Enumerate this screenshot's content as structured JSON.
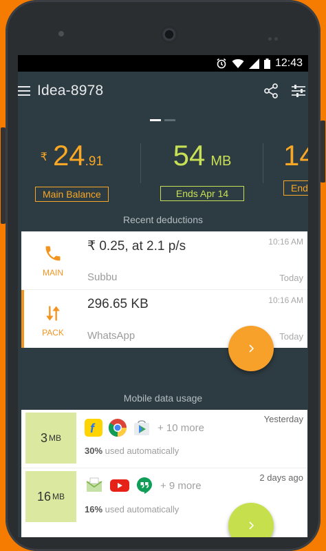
{
  "status": {
    "time": "12:43"
  },
  "appbar": {
    "title": "Idea-8978"
  },
  "balances": [
    {
      "symbol": "₹",
      "whole": "24",
      "decimal": ".91",
      "label": "Main Balance"
    },
    {
      "amount": "54",
      "unit": "MB",
      "label": "Ends Apr 14"
    },
    {
      "amount": "14",
      "label": "End"
    }
  ],
  "recent": {
    "title": "Recent deductions",
    "items": [
      {
        "type": "MAIN",
        "main": "₹ 0.25, at 2.1 p/s",
        "who": "Subbu",
        "time": "10:16 AM",
        "day": "Today"
      },
      {
        "type": "PACK",
        "main": "296.65 KB",
        "who": "WhatsApp",
        "time": "10:16 AM",
        "day": "Today"
      }
    ]
  },
  "usage": {
    "title": "Mobile data usage",
    "items": [
      {
        "amount": "3",
        "unit": "MB",
        "more": "+ 10 more",
        "pct": "30%",
        "pct_text": " used automatically",
        "when": "Yesterday",
        "apps": [
          "flipkart-app-icon",
          "chrome-app-icon",
          "play-store-app-icon"
        ]
      },
      {
        "amount": "16",
        "unit": "MB",
        "more": "+ 9 more",
        "pct": "16%",
        "pct_text": " used automatically",
        "when": "2 days ago",
        "apps": [
          "email-app-icon",
          "youtube-app-icon",
          "hangouts-app-icon"
        ]
      }
    ]
  },
  "colors": {
    "accent": "#f9a826",
    "green": "#c8e055",
    "screen_bg": "#2d3b42",
    "frame": "#f57c00"
  }
}
